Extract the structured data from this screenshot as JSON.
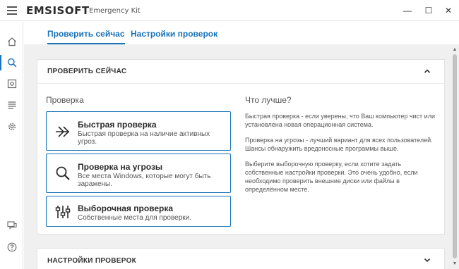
{
  "app": {
    "brand": "EMSISOFT",
    "product": "Emergency Kit"
  },
  "window_controls": {
    "minimize": "—",
    "maximize": "☐",
    "close": "✕"
  },
  "sidebar": {
    "items": [
      {
        "name": "home",
        "icon": "home-icon",
        "active": false
      },
      {
        "name": "scan",
        "icon": "search-icon",
        "active": true
      },
      {
        "name": "quarantine",
        "icon": "quarantine-icon",
        "active": false
      },
      {
        "name": "logs",
        "icon": "logs-icon",
        "active": false
      },
      {
        "name": "settings",
        "icon": "gear-icon",
        "active": false
      },
      {
        "name": "feedback",
        "icon": "chat-icon",
        "active": false
      },
      {
        "name": "help",
        "icon": "help-icon",
        "active": false
      }
    ]
  },
  "tabs": {
    "scan_now": "Проверить сейчас",
    "scan_settings": "Настройки проверок"
  },
  "panel": {
    "title": "ПРОВЕРИТЬ СЕЙЧАС",
    "left_heading": "Проверка",
    "right_heading": "Что лучше?"
  },
  "scan_types": [
    {
      "title": "Быстрая проверка",
      "description": "Быстрая проверка на наличие активных угроз.",
      "icon": "fast-forward-icon"
    },
    {
      "title": "Проверка на угрозы",
      "description": "Все места Windows, которые могут быть заражены.",
      "icon": "magnifier-icon"
    },
    {
      "title": "Выборочная проверка",
      "description": "Собственные места для проверки.",
      "icon": "sliders-icon"
    }
  ],
  "help_text": {
    "p1": "Быстрая проверка - если уверены, что Ваш компьютер чист или установлена новая операционная система.",
    "p2": "Проверка на угрозы - лучший вариант для всех пользователей. Шансы обнаружить вредоносные программы выше.",
    "p3": "Выберите выборочную проверку, если хотите задать собственные настройки проверки. Это очень удобно, если необходимо проверить внешние диски или файлы в определённом месте."
  },
  "panel2": {
    "title": "НАСТРОЙКИ ПРОВЕРОК"
  },
  "colors": {
    "accent": "#1a73b8",
    "background": "#f0f0f0"
  }
}
